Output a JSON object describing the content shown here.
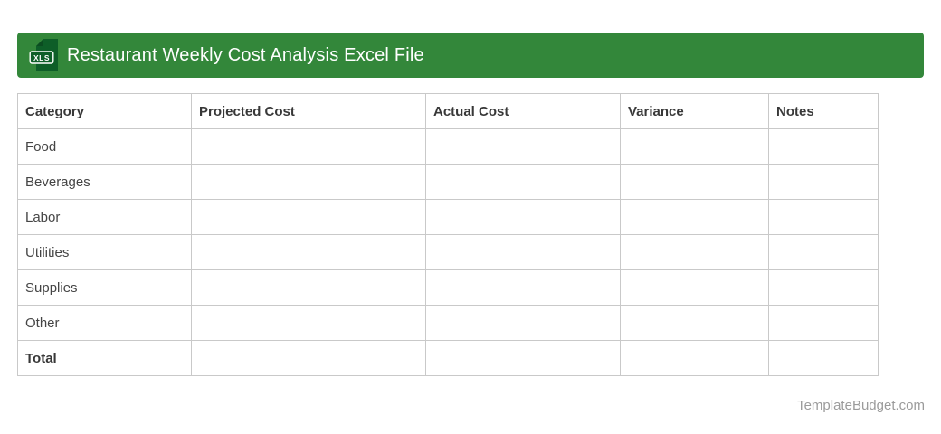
{
  "header": {
    "title": "Restaurant Weekly Cost Analysis Excel File",
    "file_badge": "XLS"
  },
  "table": {
    "columns": [
      "Category",
      "Projected Cost",
      "Actual Cost",
      "Variance",
      "Notes"
    ],
    "rows": [
      {
        "category": "Food",
        "projected_cost": "",
        "actual_cost": "",
        "variance": "",
        "notes": "",
        "is_total": false
      },
      {
        "category": "Beverages",
        "projected_cost": "",
        "actual_cost": "",
        "variance": "",
        "notes": "",
        "is_total": false
      },
      {
        "category": "Labor",
        "projected_cost": "",
        "actual_cost": "",
        "variance": "",
        "notes": "",
        "is_total": false
      },
      {
        "category": "Utilities",
        "projected_cost": "",
        "actual_cost": "",
        "variance": "",
        "notes": "",
        "is_total": false
      },
      {
        "category": "Supplies",
        "projected_cost": "",
        "actual_cost": "",
        "variance": "",
        "notes": "",
        "is_total": false
      },
      {
        "category": "Other",
        "projected_cost": "",
        "actual_cost": "",
        "variance": "",
        "notes": "",
        "is_total": false
      },
      {
        "category": "Total",
        "projected_cost": "",
        "actual_cost": "",
        "variance": "",
        "notes": "",
        "is_total": true
      }
    ]
  },
  "footer": {
    "watermark": "TemplateBudget.com"
  },
  "colors": {
    "bar_green": "#33873A",
    "icon_green": "#0E5E28",
    "icon_fold_green": "#0B4C21",
    "table_border": "#C9C9C9",
    "heading_text": "#383838",
    "body_text": "#454545",
    "watermark_text": "#9B9B9B"
  }
}
